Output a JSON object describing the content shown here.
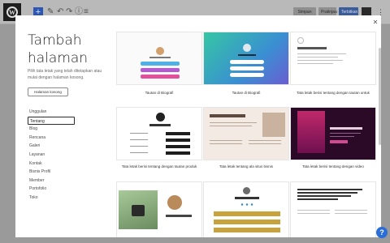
{
  "topbar": {
    "save_draft_label": "Simpan draf",
    "preview_label": "Pratinjau",
    "publish_label": "Terbitkan"
  },
  "modal": {
    "title": "Tambah halaman",
    "subtitle": "Pilih tata letak yang telah ditetapkan atau mulai dengan halaman kosong.",
    "blank_button_label": "Halaman kosong",
    "categories": [
      {
        "label": "Unggulan"
      },
      {
        "label": "Tentang"
      },
      {
        "label": "Blog"
      },
      {
        "label": "Rencana"
      },
      {
        "label": "Galeri"
      },
      {
        "label": "Layanan"
      },
      {
        "label": "Kontak"
      },
      {
        "label": "Bisnis Profil"
      },
      {
        "label": "Member"
      },
      {
        "label": "Portofolio"
      },
      {
        "label": "Toko"
      }
    ],
    "layouts": [
      {
        "caption": "Tautan di Biografi"
      },
      {
        "caption": "Tautan di Biografi"
      },
      {
        "caption": "Tata letak berisi tentang dengan tautan untuk"
      },
      {
        "caption": "Tata letak berisi tentang dengan tautan produk"
      },
      {
        "caption": "Tata letak tentang ala situs bisnis"
      },
      {
        "caption": "Tata letak berisi tentang dengan video"
      },
      {
        "caption": ""
      },
      {
        "caption": ""
      },
      {
        "caption": ""
      }
    ]
  },
  "icons": {
    "close": "close-icon",
    "help": "help-icon",
    "logo": "wordpress-logo-icon"
  }
}
